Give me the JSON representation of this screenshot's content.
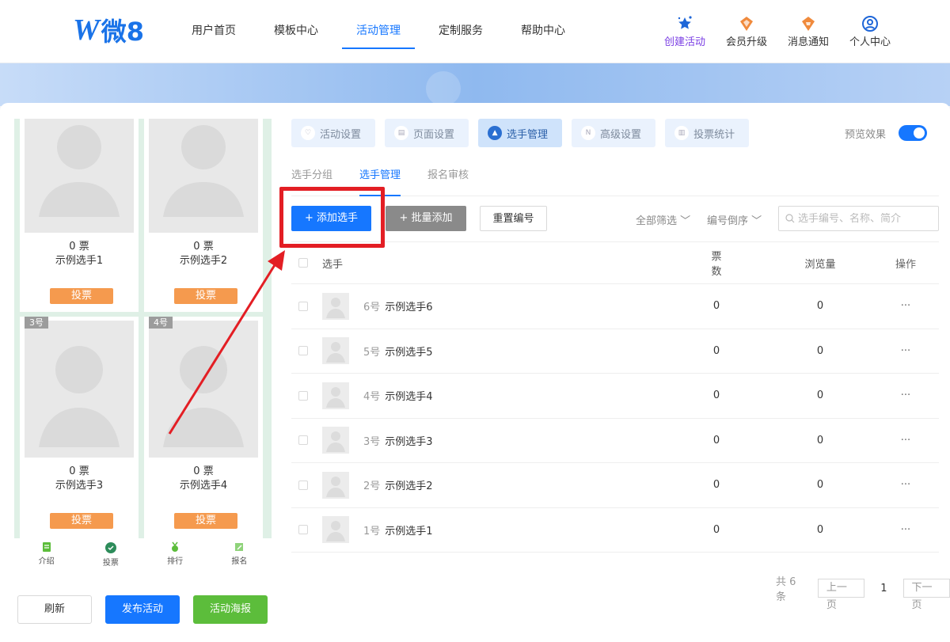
{
  "logo": {
    "mark": "W",
    "text": "微8"
  },
  "nav": [
    "用户首页",
    "模板中心",
    "活动管理",
    "定制服务",
    "帮助中心"
  ],
  "tools": [
    {
      "label": "创建活动",
      "icon": "star-sparkle-icon"
    },
    {
      "label": "会员升级",
      "icon": "member-badge-icon"
    },
    {
      "label": "消息通知",
      "icon": "bell-badge-icon"
    },
    {
      "label": "个人中心",
      "icon": "user-circle-icon"
    }
  ],
  "preview": {
    "cards": [
      {
        "votes": "0 票",
        "name": "示例选手1",
        "button": "投票",
        "num": ""
      },
      {
        "votes": "0 票",
        "name": "示例选手2",
        "button": "投票",
        "num": ""
      },
      {
        "votes": "0 票",
        "name": "示例选手3",
        "button": "投票",
        "num": "3号"
      },
      {
        "votes": "0 票",
        "name": "示例选手4",
        "button": "投票",
        "num": "4号"
      }
    ],
    "nav": [
      "介绍",
      "投票",
      "排行",
      "报名"
    ]
  },
  "bottom": {
    "refresh": "刷新",
    "publish": "发布活动",
    "poster": "活动海报"
  },
  "setting_tabs": [
    "活动设置",
    "页面设置",
    "选手管理",
    "高级设置",
    "投票统计"
  ],
  "preview_toggle": "预览效果",
  "sub_tabs": [
    "选手分组",
    "选手管理",
    "报名审核"
  ],
  "actions": {
    "add": "+ 添加选手",
    "batch": "+ 批量添加",
    "renumber": "重置编号",
    "filter_all": "全部筛选",
    "sort": "编号倒序",
    "search_placeholder": "选手编号、名称、简介"
  },
  "table": {
    "headers": {
      "player": "选手",
      "votes": "票数",
      "views": "浏览量",
      "ops": "操作"
    },
    "rows": [
      {
        "num": "6号",
        "name": "示例选手6",
        "votes": "0",
        "views": "0",
        "ops": "···"
      },
      {
        "num": "5号",
        "name": "示例选手5",
        "votes": "0",
        "views": "0",
        "ops": "···"
      },
      {
        "num": "4号",
        "name": "示例选手4",
        "votes": "0",
        "views": "0",
        "ops": "···"
      },
      {
        "num": "3号",
        "name": "示例选手3",
        "votes": "0",
        "views": "0",
        "ops": "···"
      },
      {
        "num": "2号",
        "name": "示例选手2",
        "votes": "0",
        "views": "0",
        "ops": "···"
      },
      {
        "num": "1号",
        "name": "示例选手1",
        "votes": "0",
        "views": "0",
        "ops": "···"
      }
    ]
  },
  "pager": {
    "total": "共 6 条",
    "prev": "上一页",
    "current": "1",
    "next": "下一页"
  },
  "colors": {
    "primary": "#1677ff",
    "vote_button": "#f59a4e",
    "poster": "#5cbd3b",
    "highlight": "#e31e24"
  }
}
